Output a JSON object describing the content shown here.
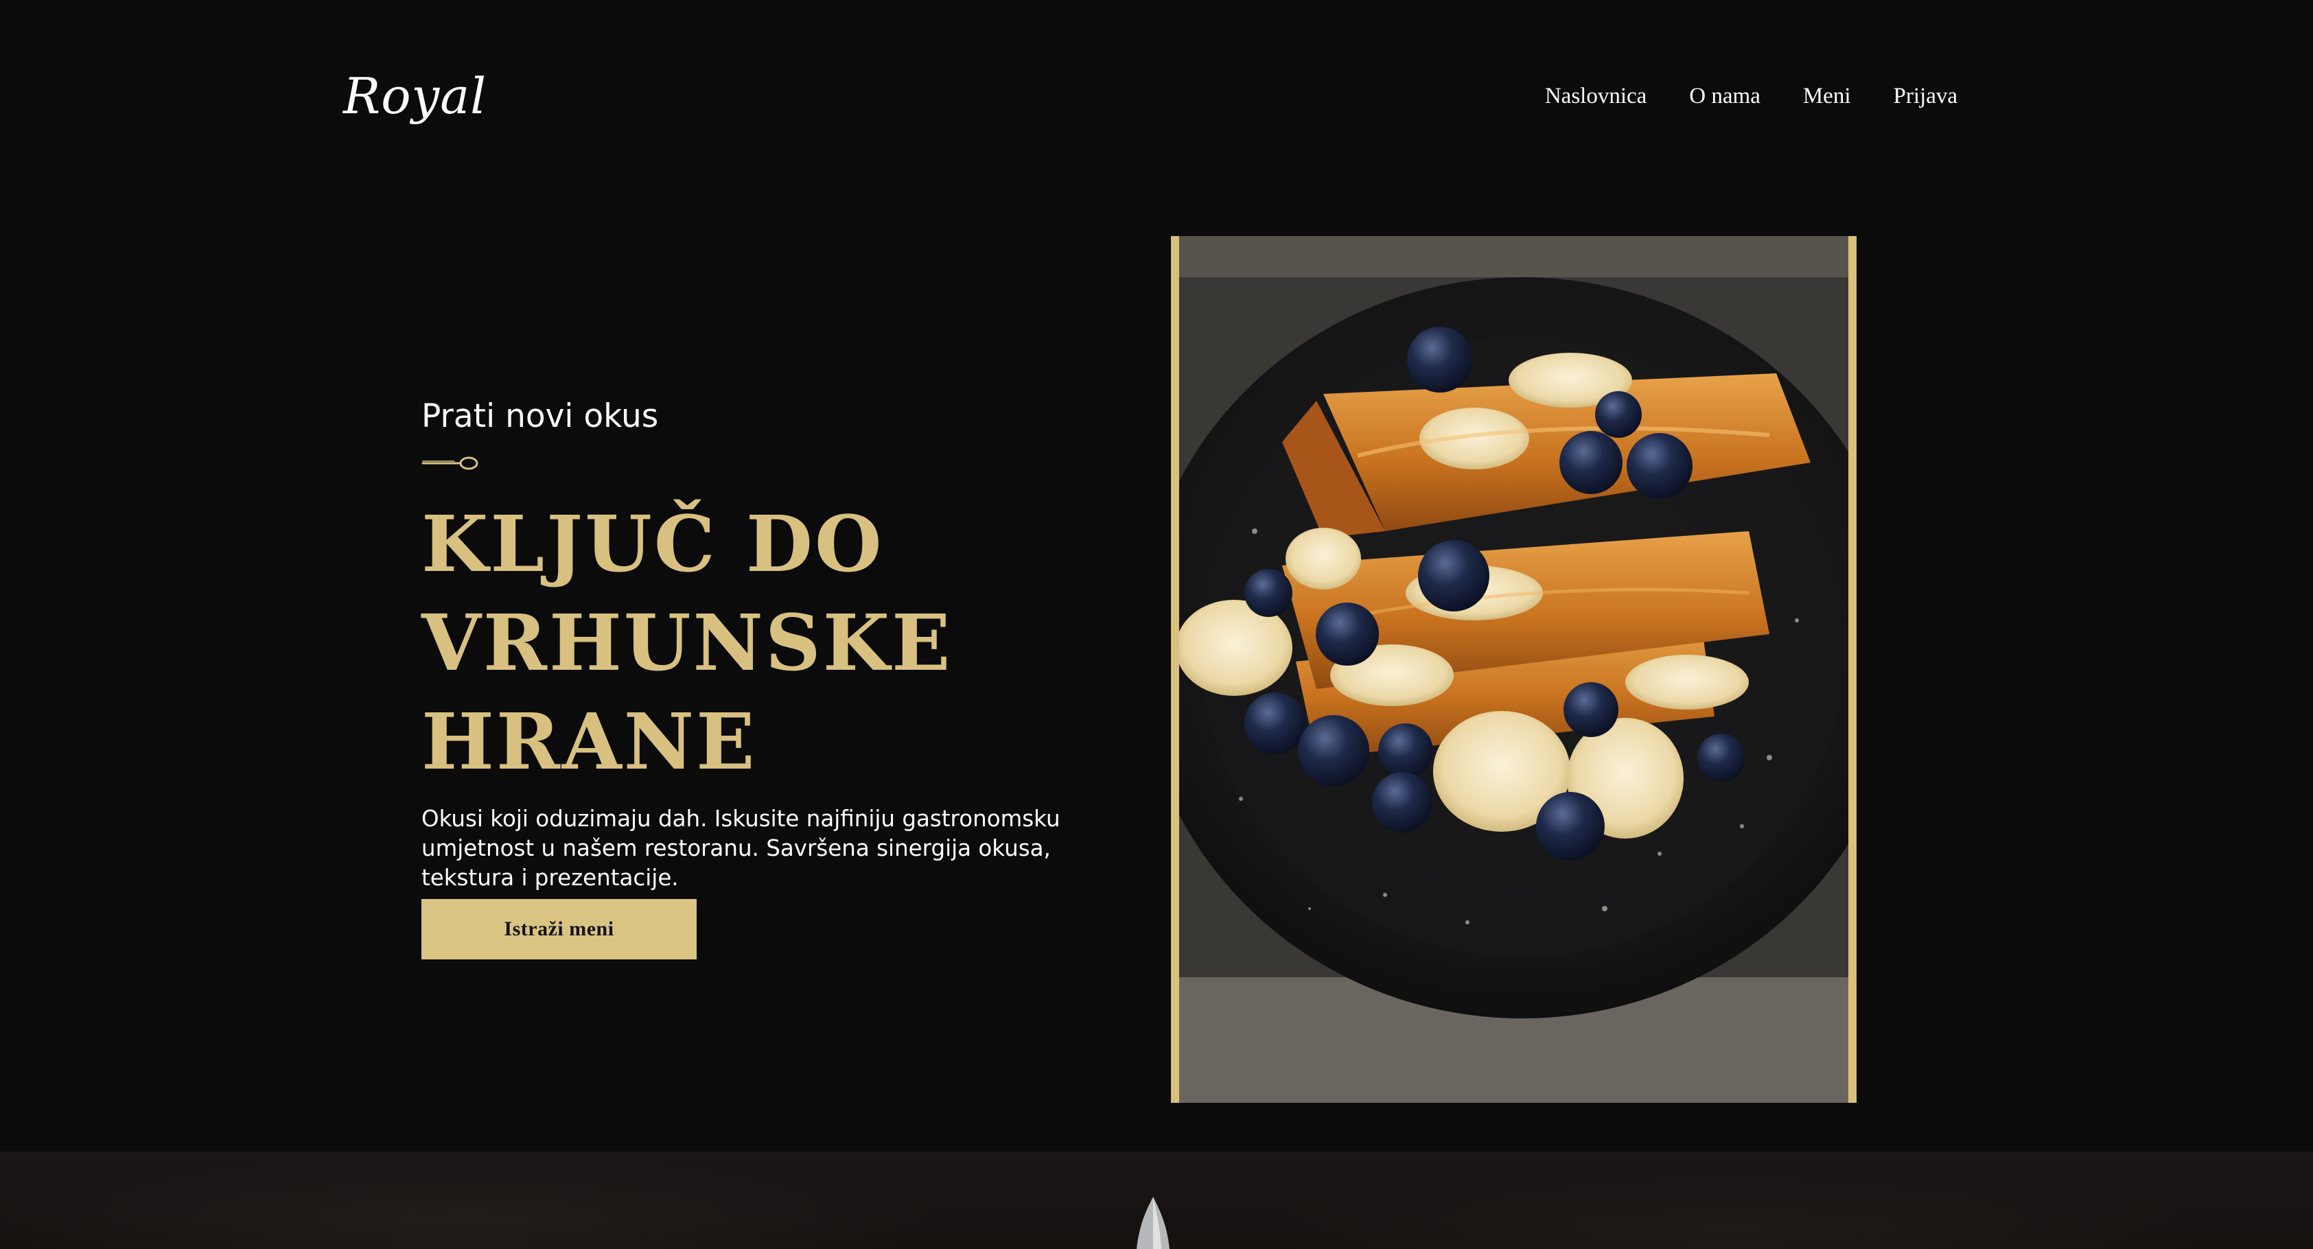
{
  "brand": {
    "logo": "Royal"
  },
  "nav": {
    "items": [
      {
        "label": "Naslovnica"
      },
      {
        "label": "O nama"
      },
      {
        "label": "Meni"
      },
      {
        "label": "Prijava"
      }
    ]
  },
  "hero": {
    "kicker": "Prati novi okus",
    "headline_lines": [
      "KLJUČ DO",
      "VRHUNSKE",
      "HRANE"
    ],
    "description": "Okusi koji oduzimaju dah. Iskusite najfiniju gastronomsku umjetnost u našem restoranu. Savršena sinergija okusa, tekstura i prezentacije.",
    "cta_label": "Istraži meni",
    "image_subject": "french toast stack with bananas and blueberries"
  },
  "colors": {
    "background": "#0b0b0c",
    "accent_gold": "#d8c180",
    "button_gold": "#dac484",
    "text_white": "#ffffff"
  },
  "icons": {
    "divider": "spoon-icon",
    "bottom_decor": "knife-icon"
  }
}
